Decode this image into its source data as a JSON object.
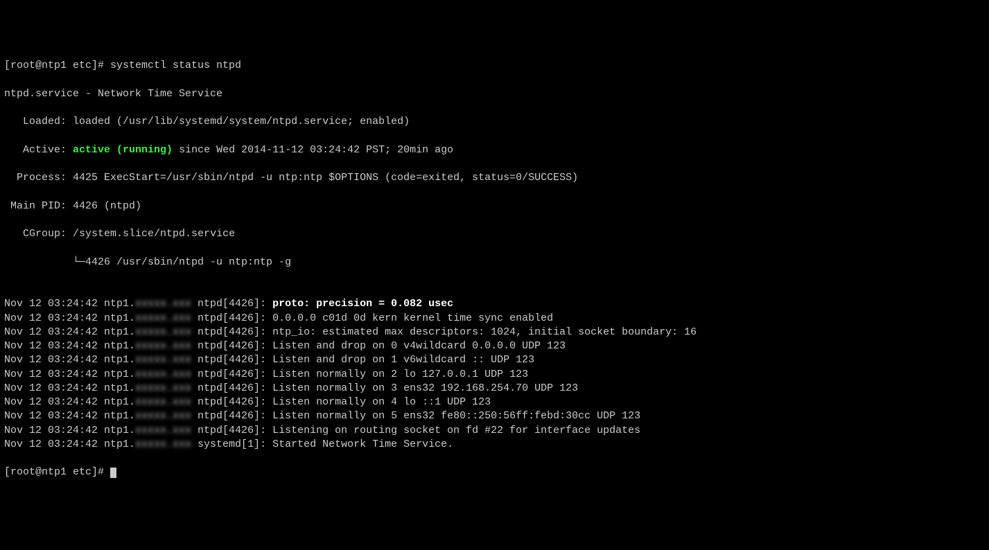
{
  "prompt1": "[root@ntp1 etc]# ",
  "command": "systemctl status ntpd",
  "service_line": "ntpd.service - Network Time Service",
  "loaded_label": "   Loaded: ",
  "loaded_value": "loaded (/usr/lib/systemd/system/ntpd.service; enabled)",
  "active_label": "   Active: ",
  "active_status": "active (running)",
  "active_since": " since Wed 2014-11-12 03:24:42 PST; 20min ago",
  "process_label": "  Process: ",
  "process_value": "4425 ExecStart=/usr/sbin/ntpd -u ntp:ntp $OPTIONS (code=exited, status=0/SUCCESS)",
  "mainpid_label": " Main PID: ",
  "mainpid_value": "4426 (ntpd)",
  "cgroup_label": "   CGroup: ",
  "cgroup_value": "/system.slice/ntpd.service",
  "cgroup_tree": "           └─4426 /usr/sbin/ntpd -u ntp:ntp -g",
  "blank": "",
  "log_prefix": "Nov 12 03:24:42 ntp1.",
  "blurred": "xxxxx.xxx",
  "logs": [
    {
      "src": " ntpd[4426]: ",
      "bold_msg": "proto: precision = 0.082 usec",
      "msg": ""
    },
    {
      "src": " ntpd[4426]: ",
      "bold_msg": "",
      "msg": "0.0.0.0 c01d 0d kern kernel time sync enabled"
    },
    {
      "src": " ntpd[4426]: ",
      "bold_msg": "",
      "msg": "ntp_io: estimated max descriptors: 1024, initial socket boundary: 16"
    },
    {
      "src": " ntpd[4426]: ",
      "bold_msg": "",
      "msg": "Listen and drop on 0 v4wildcard 0.0.0.0 UDP 123"
    },
    {
      "src": " ntpd[4426]: ",
      "bold_msg": "",
      "msg": "Listen and drop on 1 v6wildcard :: UDP 123"
    },
    {
      "src": " ntpd[4426]: ",
      "bold_msg": "",
      "msg": "Listen normally on 2 lo 127.0.0.1 UDP 123"
    },
    {
      "src": " ntpd[4426]: ",
      "bold_msg": "",
      "msg": "Listen normally on 3 ens32 192.168.254.70 UDP 123"
    },
    {
      "src": " ntpd[4426]: ",
      "bold_msg": "",
      "msg": "Listen normally on 4 lo ::1 UDP 123"
    },
    {
      "src": " ntpd[4426]: ",
      "bold_msg": "",
      "msg": "Listen normally on 5 ens32 fe80::250:56ff:febd:30cc UDP 123"
    },
    {
      "src": " ntpd[4426]: ",
      "bold_msg": "",
      "msg": "Listening on routing socket on fd #22 for interface updates"
    },
    {
      "src": " systemd[1]: ",
      "bold_msg": "",
      "msg": "Started Network Time Service."
    }
  ],
  "prompt2": "[root@ntp1 etc]# "
}
